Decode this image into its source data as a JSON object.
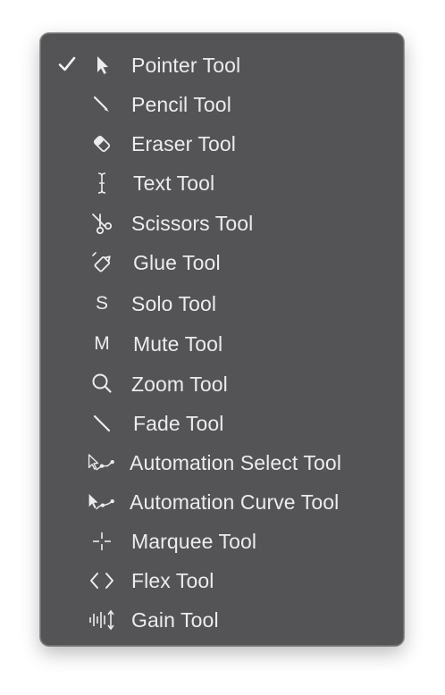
{
  "menu": {
    "items": [
      {
        "label": "Pointer Tool",
        "icon": "pointer-icon",
        "checked": true
      },
      {
        "label": "Pencil Tool",
        "icon": "pencil-icon",
        "checked": false
      },
      {
        "label": "Eraser Tool",
        "icon": "eraser-icon",
        "checked": false
      },
      {
        "label": "Text Tool",
        "icon": "text-cursor-icon",
        "checked": false
      },
      {
        "label": "Scissors Tool",
        "icon": "scissors-icon",
        "checked": false
      },
      {
        "label": "Glue Tool",
        "icon": "glue-icon",
        "checked": false
      },
      {
        "label": "Solo Tool",
        "icon": "solo-icon",
        "icon_text": "S",
        "checked": false
      },
      {
        "label": "Mute Tool",
        "icon": "mute-icon",
        "icon_text": "M",
        "checked": false
      },
      {
        "label": "Zoom Tool",
        "icon": "zoom-icon",
        "checked": false
      },
      {
        "label": "Fade Tool",
        "icon": "fade-icon",
        "checked": false
      },
      {
        "label": "Automation Select Tool",
        "icon": "automation-select-icon",
        "checked": false
      },
      {
        "label": "Automation Curve Tool",
        "icon": "automation-curve-icon",
        "checked": false
      },
      {
        "label": "Marquee Tool",
        "icon": "marquee-icon",
        "checked": false
      },
      {
        "label": "Flex Tool",
        "icon": "flex-icon",
        "checked": false
      },
      {
        "label": "Gain Tool",
        "icon": "gain-icon",
        "checked": false
      }
    ]
  },
  "colors": {
    "menu_background": "#545356",
    "text": "#ececec"
  }
}
